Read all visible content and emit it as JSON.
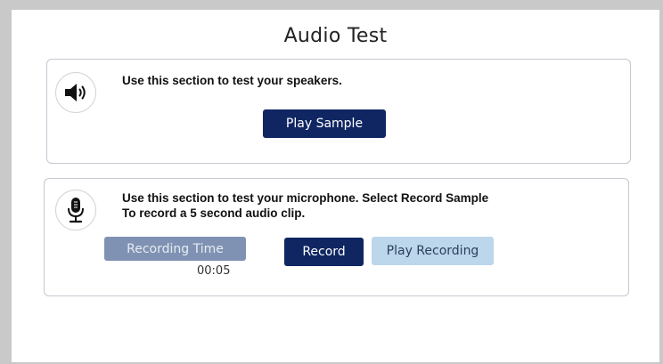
{
  "page": {
    "title": "Audio Test"
  },
  "speaker_section": {
    "icon": "speaker-icon",
    "description": "Use this section to test your speakers.",
    "play_sample_label": "Play Sample"
  },
  "mic_section": {
    "icon": "microphone-icon",
    "description_line1": "Use this section to test your microphone. Select Record Sample",
    "description_line2": "To record a 5 second audio clip.",
    "recording_time_label": "Recording Time",
    "recording_time_value": "00:05",
    "record_label": "Record",
    "play_recording_label": "Play Recording"
  },
  "colors": {
    "primary_button": "#0f2662",
    "secondary_button": "#bcd6ec",
    "disabled_button": "#7f92b3",
    "frame": "#c9c9c9"
  }
}
